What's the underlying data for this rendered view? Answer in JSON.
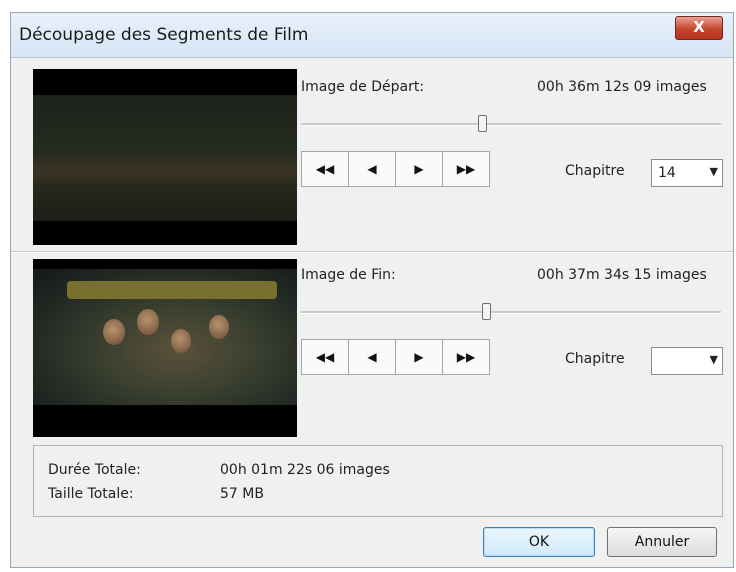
{
  "window": {
    "title": "Découpage des Segments de Film",
    "close_label": "X"
  },
  "start": {
    "label": "Image de Départ:",
    "time": "00h 36m 12s 09 images",
    "slider_position": 0.43,
    "chapter_label": "Chapitre",
    "chapter_value": "14"
  },
  "end": {
    "label": "Image de Fin:",
    "time": "00h 37m 34s 15 images",
    "slider_position": 0.44,
    "chapter_label": "Chapitre",
    "chapter_value": ""
  },
  "nav": {
    "first": "◀◀",
    "prev": "◀",
    "next": "▶",
    "last": "▶▶"
  },
  "summary": {
    "duration_label": "Durée Totale:",
    "duration_value": "00h 01m 22s 06 images",
    "size_label": "Taille Totale:",
    "size_value": "57 MB"
  },
  "buttons": {
    "ok": "OK",
    "cancel": "Annuler"
  },
  "icons": {
    "close": "close-icon",
    "first": "skip-to-start-icon",
    "prev": "step-back-icon",
    "next": "step-forward-icon",
    "last": "skip-to-end-icon",
    "dropdown": "chevron-down-icon"
  }
}
